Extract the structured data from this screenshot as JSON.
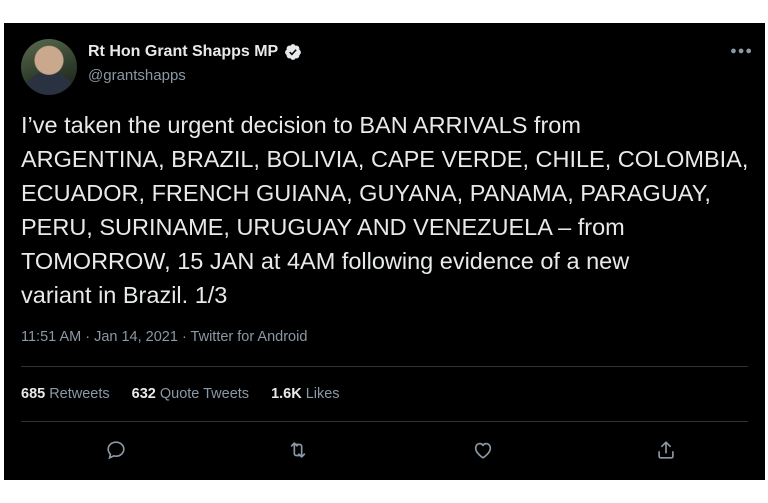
{
  "tweet": {
    "author": {
      "display_name": "Rt Hon Grant Shapps MP",
      "handle": "@grantshapps",
      "verified": true
    },
    "more_icon": "more-dots-icon",
    "text": "I’ve taken the urgent decision to BAN ARRIVALS from\nARGENTINA, BRAZIL, BOLIVIA, CAPE VERDE, CHILE, COLOMBIA,\nECUADOR, FRENCH GUIANA, GUYANA, PANAMA, PARAGUAY,\nPERU, SURINAME, URUGUAY AND VENEZUELA – from\nTOMORROW, 15 JAN at 4AM following evidence of a new\nvariant in Brazil. 1/3",
    "meta": "11:51 AM · Jan 14, 2021 · Twitter for Android",
    "stats": [
      {
        "count": "685",
        "label": "Retweets"
      },
      {
        "count": "632",
        "label": "Quote Tweets"
      },
      {
        "count": "1.6K",
        "label": "Likes"
      }
    ],
    "actions": [
      "reply-icon",
      "retweet-icon",
      "like-icon",
      "share-icon"
    ]
  },
  "colors": {
    "background": "#000000",
    "text": "#e7e9ea",
    "secondary_text": "#8b98a5",
    "verified": "#1d9bf0"
  }
}
